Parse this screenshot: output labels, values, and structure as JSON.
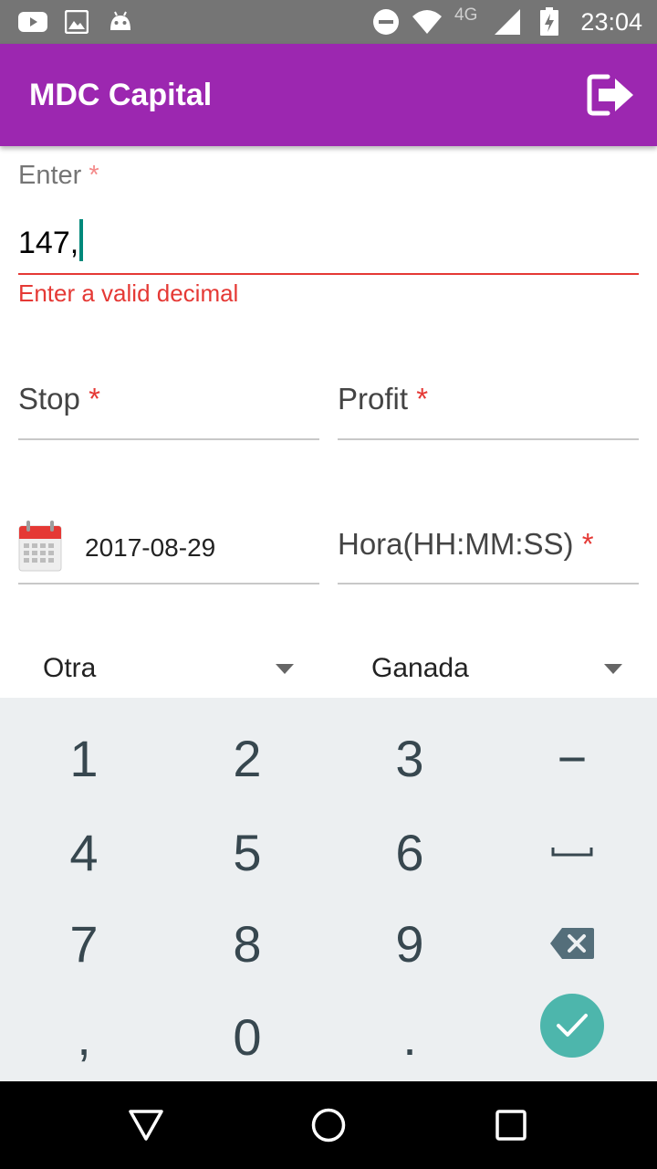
{
  "status_bar": {
    "time": "23:04",
    "network_type": "4G",
    "icons": [
      "youtube-icon",
      "gallery-icon",
      "android-icon",
      "do-not-disturb-icon",
      "wifi-icon",
      "signal-icon",
      "battery-charging-icon"
    ]
  },
  "app_bar": {
    "title": "MDC Capital",
    "action_icon": "logout-icon",
    "color": "#9c27b0"
  },
  "form": {
    "enter": {
      "label": "Enter",
      "required_mark": "*",
      "value": "147,",
      "error": "Enter a valid decimal"
    },
    "stop": {
      "label": "Stop",
      "required_mark": "*"
    },
    "profit": {
      "label": "Profit",
      "required_mark": "*"
    },
    "date": {
      "icon": "calendar-icon",
      "value": "2017-08-29"
    },
    "time": {
      "label": "Hora(HH:MM:SS)",
      "required_mark": "*"
    },
    "spinner_type": {
      "selected": "Otra"
    },
    "spinner_result": {
      "selected": "Ganada"
    }
  },
  "keyboard": {
    "rows": [
      [
        "1",
        "2",
        "3",
        "−"
      ],
      [
        "4",
        "5",
        "6",
        "space"
      ],
      [
        "7",
        "8",
        "9",
        "backspace"
      ],
      [
        ",",
        "0",
        ".",
        "done"
      ]
    ],
    "digit_keys": [
      "1",
      "2",
      "3",
      "4",
      "5",
      "6",
      "7",
      "8",
      "9",
      ",",
      "0",
      "."
    ],
    "minus_key": "−",
    "accent_color": "#4db6ac"
  },
  "nav_bar": {
    "buttons": [
      "back-icon",
      "home-icon",
      "recents-icon"
    ]
  }
}
